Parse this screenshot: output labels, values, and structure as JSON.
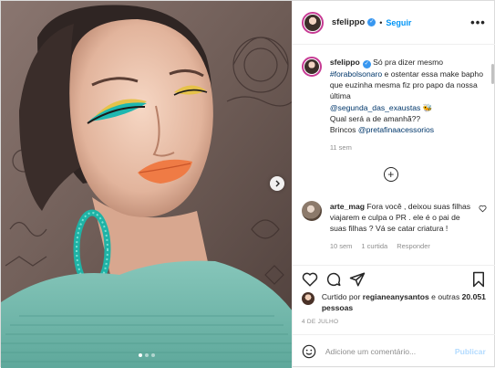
{
  "post": {
    "author": "sfelippo",
    "separator": "•",
    "follow_label": "Seguir",
    "more_label": "•••"
  },
  "caption": {
    "username": "sfelippo",
    "line1": " Só pra dizer mesmo",
    "hashtag": "#forabolsonaro",
    "line2": " e ostentar essa make bapho que euzinha mesma fiz pro papo da nossa última",
    "mention1": "@segunda_das_exaustas",
    "emoji": " 🐝",
    "line3": "Qual será a de amanhã??",
    "brincos": "Brincos ",
    "mention2": "@pretafinaacessorios",
    "time": "11 sem"
  },
  "load_more_symbol": "+",
  "comment": {
    "username": "arte_mag",
    "text": " Fora você , deixou suas filhas viajarem e culpa o PR . ele é o pai de suas filhas ? Vá se catar criatura !",
    "time": "10 sem",
    "likes": "1 curtida",
    "reply": "Responder"
  },
  "likes": {
    "prefix": "Curtido por ",
    "user": "regianeanysantos",
    "middle": " e outras ",
    "count": "20.051 pessoas"
  },
  "date": "4 DE JULHO",
  "add_comment": {
    "placeholder": "Adicione um comentário...",
    "publish_label": "Publicar"
  },
  "colors": {
    "accent": "#0095f6",
    "verified": "#3897f0",
    "story_ring": "#c73b94",
    "publish_disabled": "#b3dbff"
  },
  "icons": [
    "chevron-right-icon",
    "verified-icon",
    "heart-icon",
    "comment-icon",
    "share-icon",
    "bookmark-icon",
    "emoji-icon",
    "plus-circle-icon"
  ]
}
